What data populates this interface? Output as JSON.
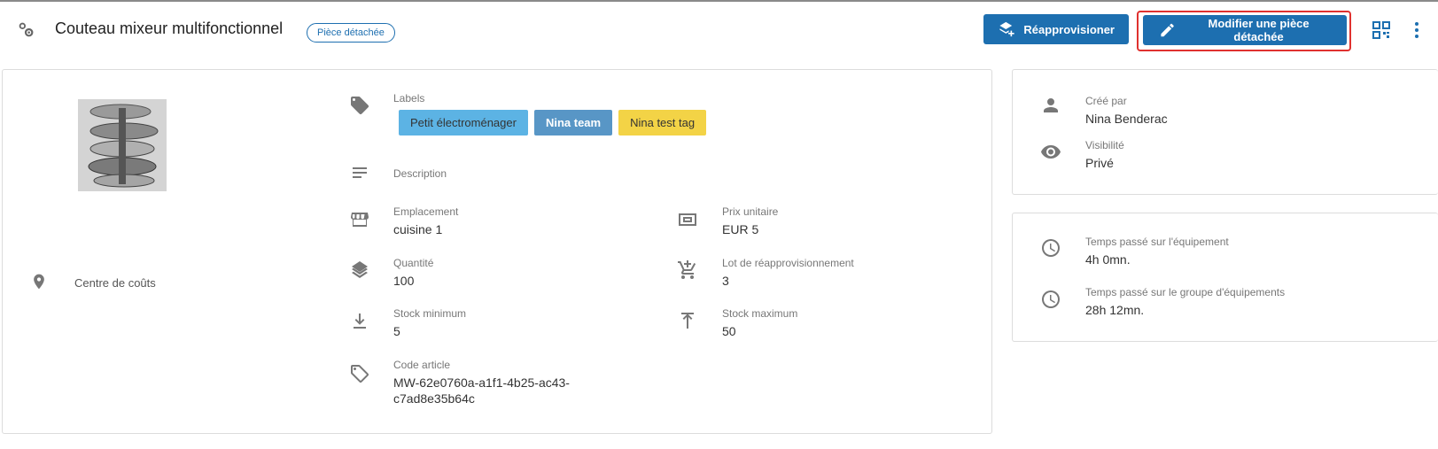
{
  "header": {
    "title": "Couteau mixeur multifonctionnel",
    "badge": "Pièce détachée",
    "restock_button": "Réapprovisioner",
    "edit_button": "Modifier une pièce détachée"
  },
  "left_panel": {
    "photo_icon": "mixer-blade-image",
    "cost_center_label": "Centre de coûts"
  },
  "details": {
    "labels_label": "Labels",
    "tags": [
      "Petit électroménager",
      "Nina team",
      "Nina test tag"
    ],
    "description_label": "Description",
    "location_label": "Emplacement",
    "location_value": "cuisine 1",
    "unit_price_label": "Prix unitaire",
    "unit_price_value": "EUR 5",
    "quantity_label": "Quantité",
    "quantity_value": "100",
    "restock_lot_label": "Lot de réapprovisionnement",
    "restock_lot_value": "3",
    "min_stock_label": "Stock minimum",
    "min_stock_value": "5",
    "max_stock_label": "Stock maximum",
    "max_stock_value": "50",
    "article_code_label": "Code article",
    "article_code_line1": "MW-62e0760a-a1f1-4b25-ac43-",
    "article_code_line2": "c7ad8e35b64c"
  },
  "created": {
    "created_by_label": "Créé par",
    "created_by_value": "Nina Benderac",
    "visibility_label": "Visibilité",
    "visibility_value": "Privé"
  },
  "time": {
    "equipment_label": "Temps passé sur l'équipement",
    "equipment_value": "4h 0mn.",
    "group_label": "Temps passé sur le groupe d'équipements",
    "group_value": "28h 12mn."
  },
  "colors": {
    "primary": "#1d6fb0",
    "highlight_border": "#e0312f",
    "tag_light_blue": "#5cb3e4",
    "tag_blue": "#5896c6",
    "tag_yellow": "#f3d346"
  }
}
